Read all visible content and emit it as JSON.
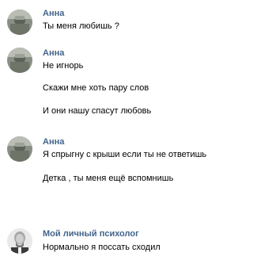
{
  "messages": [
    {
      "sender": "Анна",
      "avatar_icon": "user-photo-icon",
      "lines": [
        "Ты меня любишь ?"
      ]
    },
    {
      "sender": "Анна",
      "avatar_icon": "user-photo-icon",
      "lines": [
        "Не игнорь",
        "Скажи мне хоть пару слов",
        "И они нашу спасут любовь"
      ]
    },
    {
      "sender": "Анна",
      "avatar_icon": "user-photo-icon",
      "lines": [
        "Я спрыгну с крыши если ты не ответишь",
        "Детка , ты меня ещё вспомнишь"
      ]
    },
    {
      "sender": "Мой личный психолог",
      "avatar_icon": "psychologist-portrait-icon",
      "lines": [
        "Нормально я поссать сходил"
      ]
    }
  ],
  "colors": {
    "sender_name": "#42648b",
    "text": "#000000",
    "background": "#ffffff"
  }
}
